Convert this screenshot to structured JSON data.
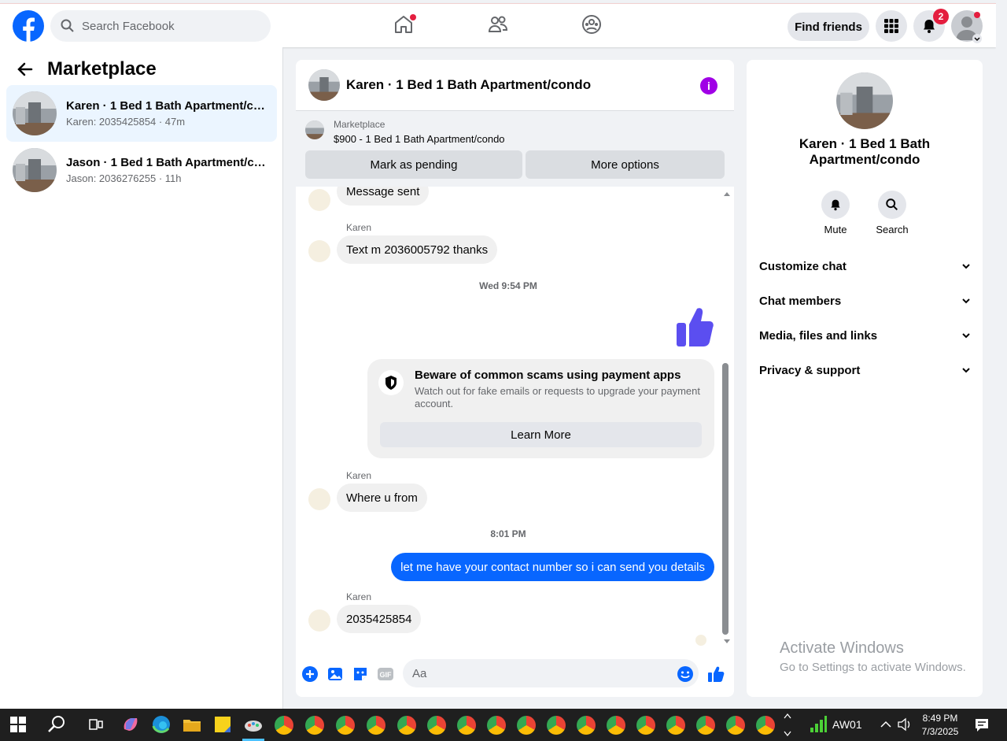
{
  "topbar": {
    "search_placeholder": "Search Facebook",
    "find_friends": "Find friends",
    "notification_count": "2"
  },
  "sidebar": {
    "title": "Marketplace",
    "conversations": [
      {
        "title": "Karen · 1 Bed 1 Bath Apartment/condo",
        "subtitle": "Karen: 2035425854 · 47m",
        "active": true
      },
      {
        "title": "Jason · 1 Bed 1 Bath Apartment/condo",
        "subtitle": "Jason: 2036276255 · 11h",
        "active": false
      }
    ]
  },
  "chat": {
    "title": "Karen · 1 Bed 1 Bath Apartment/condo",
    "marketplace_label": "Marketplace",
    "listing": "$900 - 1 Bed 1 Bath Apartment/condo",
    "mark_pending": "Mark as pending",
    "more_options": "More options",
    "messages": {
      "m1": "Message sent",
      "sender": "Karen",
      "m2": "Text m 2036005792 thanks",
      "ts1": "Wed 9:54 PM",
      "scam_title": "Beware of common scams using payment apps",
      "scam_desc": "Watch out for fake emails or requests to upgrade your payment account.",
      "learn_more": "Learn More",
      "m3": "Where u from",
      "ts2": "8:01 PM",
      "m4": "let me have your contact number so i can send you details",
      "m5": "2035425854"
    },
    "composer_placeholder": "Aa"
  },
  "rpanel": {
    "title": "Karen · 1 Bed 1 Bath Apartment/condo",
    "mute": "Mute",
    "search": "Search",
    "rows": [
      "Customize chat",
      "Chat members",
      "Media, files and links",
      "Privacy & support"
    ]
  },
  "watermark": {
    "line1": "Activate Windows",
    "line2": "Go to Settings to activate Windows."
  },
  "taskbar": {
    "network": "AW01",
    "time": "8:49 PM",
    "date": "7/3/2025"
  },
  "colors": {
    "brand": "#0866ff",
    "accent_purple": "#a000e6",
    "thumb": "#5b4ef0"
  }
}
